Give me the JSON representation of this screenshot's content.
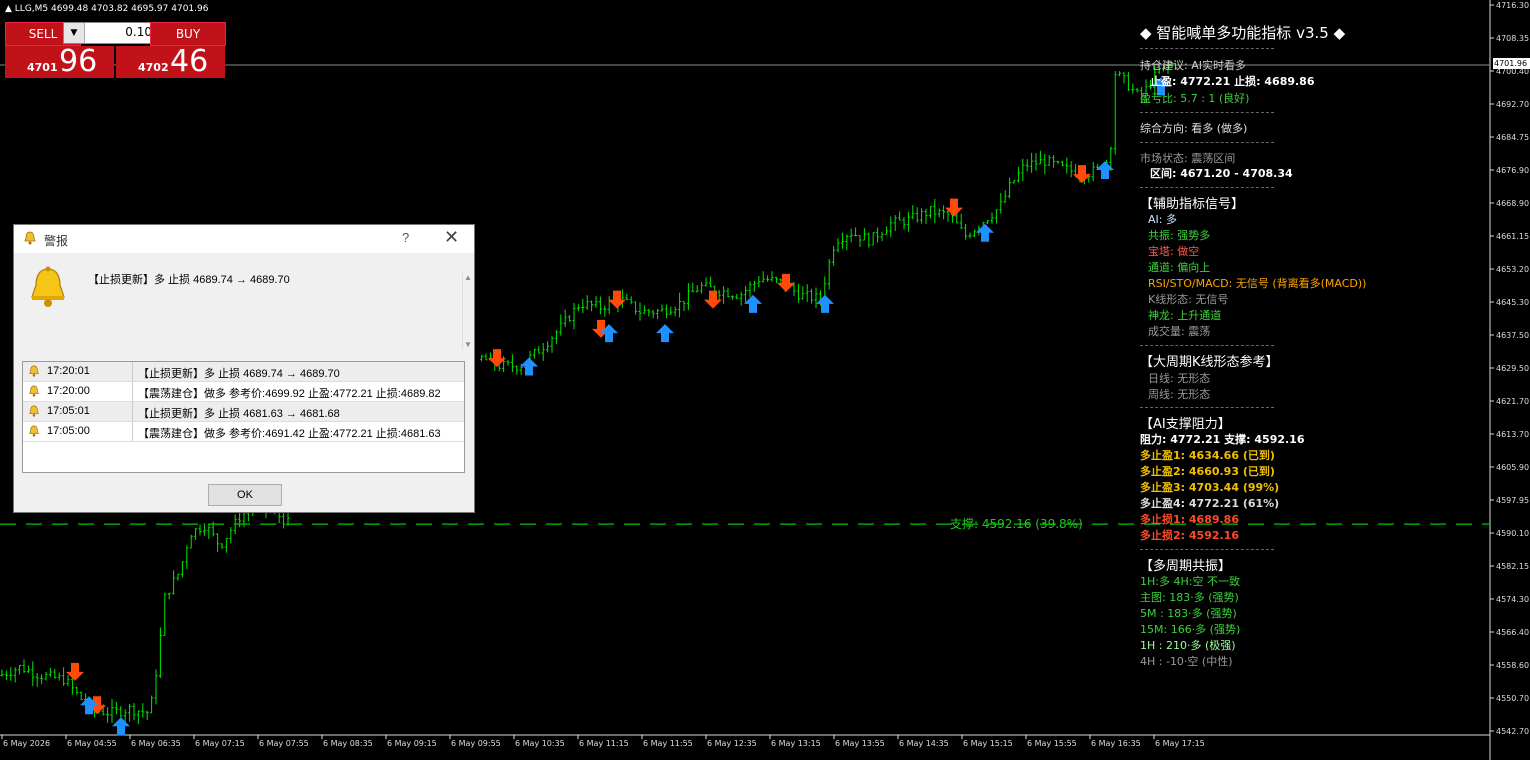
{
  "symbol_bar": "LLG,M5  4699.48 4703.82 4695.97 4701.96",
  "trade_panel": {
    "sell_label": "SELL",
    "buy_label": "BUY",
    "lot_value": "0.10",
    "bid_small": "4701",
    "bid_big": "96",
    "ask_small": "4702",
    "ask_big": "46"
  },
  "current_price_label": "4701.96",
  "price_axis": [
    "4716.30",
    "4708.35",
    "4700.40",
    "4692.70",
    "4684.75",
    "4676.90",
    "4668.90",
    "4661.15",
    "4653.20",
    "4645.30",
    "4637.50",
    "4629.50",
    "4621.70",
    "4613.70",
    "4605.90",
    "4597.95",
    "4590.10",
    "4582.15",
    "4574.30",
    "4566.40",
    "4558.60",
    "4550.70",
    "4542.70"
  ],
  "time_axis": [
    "6 May 2026",
    "6 May 04:55",
    "6 May 06:35",
    "6 May 07:15",
    "6 May 07:55",
    "6 May 08:35",
    "6 May 09:15",
    "6 May 09:55",
    "6 May 10:35",
    "6 May 11:15",
    "6 May 11:55",
    "6 May 12:35",
    "6 May 13:15",
    "6 May 13:55",
    "6 May 14:35",
    "6 May 15:15",
    "6 May 15:55",
    "6 May 16:35",
    "6 May 17:15"
  ],
  "support_line_label": "支撑: 4592.16 (39.8%)",
  "colors": {
    "candle": "#00e600",
    "down_arrow": "#ff4a0a",
    "up_arrow": "#1e90ff",
    "support_line": "#00c800",
    "sell_button": "#c1121a"
  },
  "dialog": {
    "title": "警报",
    "help": "?",
    "message": "【止损更新】多 止损 4689.74 → 4689.70",
    "ok_label": "OK",
    "rows": [
      {
        "time": "17:20:01",
        "text": "【止损更新】多 止损 4689.74 → 4689.70"
      },
      {
        "time": "17:20:00",
        "text": "【震荡建仓】做多 参考价:4699.92 止盈:4772.21 止损:4689.82"
      },
      {
        "time": "17:05:01",
        "text": "【止损更新】多 止损 4681.63 → 4681.68"
      },
      {
        "time": "17:05:00",
        "text": "【震荡建仓】做多 参考价:4691.42 止盈:4772.21 止损:4681.63"
      }
    ]
  },
  "indicator": {
    "title": "◆ 智能喊单多功能指标 v3.5 ◆",
    "advice": "持仓建议: AI实时看多",
    "tp_sl": "止盈: 4772.21  止损: 4689.86",
    "rr": "盈亏比: 5.7 : 1 (良好)",
    "direction": "综合方向: 看多 (做多)",
    "market_state": "市场状态: 震荡区间",
    "range": "区间: 4671.20 - 4708.34",
    "aux_header": "【辅助指标信号】",
    "aux": [
      {
        "text": "AI: 多",
        "color": "#cfe3ff"
      },
      {
        "text": "共振: 强势多",
        "color": "#3cd23c"
      },
      {
        "text": "宝塔: 做空",
        "color": "#ff5a4a"
      },
      {
        "text": "通道: 偏向上",
        "color": "#3cd23c"
      },
      {
        "text": "RSI/STO/MACD: 无信号 (背离看多(MACD))",
        "color": "#ffa500"
      },
      {
        "text": "K线形态: 无信号",
        "color": "#9a9a9a"
      },
      {
        "text": "神龙: 上升通道",
        "color": "#3cd23c"
      },
      {
        "text": "成交量: 震荡",
        "color": "#9a9a9a"
      }
    ],
    "period_header": "【大周期K线形态参考】",
    "period": [
      "日线: 无形态",
      "周线: 无形态"
    ],
    "sr_header": "【AI支撑阻力】",
    "sr_line": "阻力: 4772.21   支撑: 4592.16",
    "targets": [
      {
        "text": "多止盈1: 4634.66 (已到)",
        "color": "#f0c000"
      },
      {
        "text": "多止盈2: 4660.93 (已到)",
        "color": "#f0c000"
      },
      {
        "text": "多止盈3: 4703.44 (99%)",
        "color": "#f0c000"
      },
      {
        "text": "多止盈4: 4772.21 (61%)",
        "color": "#dcdcdc"
      },
      {
        "text": "多止损1: 4689.86",
        "color": "#ff4a2a"
      },
      {
        "text": "多止损2: 4592.16",
        "color": "#ff4a2a"
      }
    ],
    "multi_header": "【多周期共振】",
    "multi": [
      {
        "text": "1H:多 4H:空 不一致",
        "color": "#3cd23c"
      },
      {
        "text": "主图: 183·多 (强势)",
        "color": "#3cd23c"
      },
      {
        "text": "5M : 183·多 (强势)",
        "color": "#3cd23c"
      },
      {
        "text": "15M: 166·多 (强势)",
        "color": "#3cd23c"
      },
      {
        "text": "1H : 210·多 (极强)",
        "color": "#9cff9c"
      },
      {
        "text": "4H : -10·空 (中性)",
        "color": "#9a9a9a"
      }
    ]
  }
}
